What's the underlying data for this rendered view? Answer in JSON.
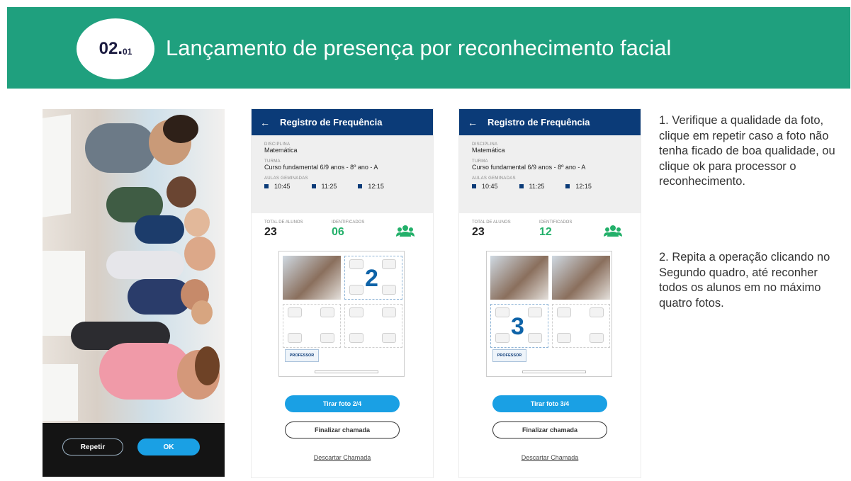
{
  "header": {
    "badge_number": "02.",
    "badge_sub": "01",
    "title": "Lançamento de presença por reconhecimento facial"
  },
  "camera": {
    "repeat_label": "Repetir",
    "ok_label": "OK"
  },
  "screens": [
    {
      "title": "Registro de Frequência",
      "discipline_label": "DISCIPLINA",
      "discipline": "Matemática",
      "class_label": "TURMA",
      "class": "Curso fundamental 6/9 anos - 8º ano - A",
      "lessons_label": "AULAS GEMINADAS",
      "times": [
        "10:45",
        "11:25",
        "12:15"
      ],
      "total_label": "TOTAL DE ALUNOS",
      "total": "23",
      "identified_label": "IDENTIFICADOS",
      "identified": "06",
      "frame_number": "2",
      "professor_label": "PROFESSOR",
      "take_photo_label": "Tirar foto 2/4",
      "finish_label": "Finalizar chamada",
      "discard_label": "Descartar Chamada"
    },
    {
      "title": "Registro de Frequência",
      "discipline_label": "DISCIPLINA",
      "discipline": "Matemática",
      "class_label": "TURMA",
      "class": "Curso fundamental 6/9 anos - 8º ano - A",
      "lessons_label": "AULAS GEMINADAS",
      "times": [
        "10:45",
        "11:25",
        "12:15"
      ],
      "total_label": "TOTAL DE ALUNOS",
      "total": "23",
      "identified_label": "IDENTIFICADOS",
      "identified": "12",
      "frame_number": "3",
      "professor_label": "PROFESSOR",
      "take_photo_label": "Tirar foto 3/4",
      "finish_label": "Finalizar chamada",
      "discard_label": "Descartar Chamada"
    }
  ],
  "instructions": {
    "step1": "1. Verifique a qualidade da foto, clique em repetir caso a foto não tenha ficado de boa qualidade, ou clique ok para processor o reconhecimento.",
    "step2": "2. Repita a operação clicando no Segundo quadro, até reconher todos os alunos em no máximo quatro fotos."
  },
  "colors": {
    "header_green": "#1fa07e",
    "navy": "#0b3b78",
    "accent_blue": "#1aa0e4",
    "identified_green": "#23b06a"
  }
}
